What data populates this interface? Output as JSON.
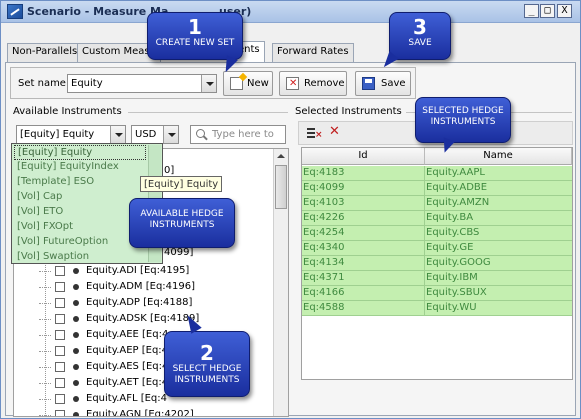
{
  "window": {
    "title": "Scenario - Measure Ma",
    "title_suffix": "user)",
    "controls": [
      "_",
      "□",
      "X"
    ]
  },
  "tabs": [
    {
      "label": "Non-Parallels"
    },
    {
      "label": "Custom Measu"
    },
    {
      "label": "ents"
    },
    {
      "label": "Forward Rates"
    }
  ],
  "set_row": {
    "label": "Set name:",
    "value": "Equity",
    "new_label": "New",
    "remove_label": "Remove",
    "save_label": "Save"
  },
  "available": {
    "section_title": "Available Instruments",
    "type_value": "[Equity] Equity",
    "currency_value": "USD",
    "search_placeholder": "Type here to",
    "dropdown_items": [
      "[Equity] Equity",
      "[Equity] EquityIndex",
      "[Template] ESO",
      "[Vol] Cap",
      "[Vol] ETO",
      "[Vol] FXOpt",
      "[Vol] FutureOption",
      "[Vol] Swaption"
    ],
    "tooltip": "[Equity] Equity",
    "partial_labels": [
      "0]",
      "4099]"
    ],
    "tree_items": [
      "Equity.ADI [Eq:4195]",
      "Equity.ADM [Eq:4196]",
      "Equity.ADP [Eq:4188]",
      "Equity.ADSK [Eq:4189]",
      "Equity.AEE [Eq:4",
      "Equity.AEP [Eq:4",
      "Equity.AES [Eq:4",
      "Equity.AET [Eq:4",
      "Equity.AFL [Eq:4",
      "Equity.AGN [Eq:4202]"
    ]
  },
  "selected": {
    "section_title": "Selected Instruments",
    "columns": [
      "Id",
      "Name"
    ],
    "rows": [
      [
        "Eq:4183",
        "Equity.AAPL"
      ],
      [
        "Eq:4099",
        "Equity.ADBE"
      ],
      [
        "Eq:4103",
        "Equity.AMZN"
      ],
      [
        "Eq:4226",
        "Equity.BA"
      ],
      [
        "Eq:4254",
        "Equity.CBS"
      ],
      [
        "Eq:4340",
        "Equity.GE"
      ],
      [
        "Eq:4134",
        "Equity.GOOG"
      ],
      [
        "Eq:4371",
        "Equity.IBM"
      ],
      [
        "Eq:4166",
        "Equity.SBUX"
      ],
      [
        "Eq:4588",
        "Equity.WU"
      ]
    ]
  },
  "callouts": {
    "c1": {
      "num": "1",
      "text": "CREATE NEW SET"
    },
    "c2": {
      "num": "2",
      "text": "SELECT HEDGE INSTRUMENTS"
    },
    "c3": {
      "num": "3",
      "text": "SAVE"
    },
    "avail": {
      "text": "AVAILABLE HEDGE INSTRUMENTS"
    },
    "sel": {
      "text": "SELECTED HEDGE INSTRUMENTS"
    }
  },
  "colors": {
    "callout_blue": "#2a3fc0",
    "selection_green": "#c4efb0",
    "dropdown_green": "#cfeecf"
  }
}
